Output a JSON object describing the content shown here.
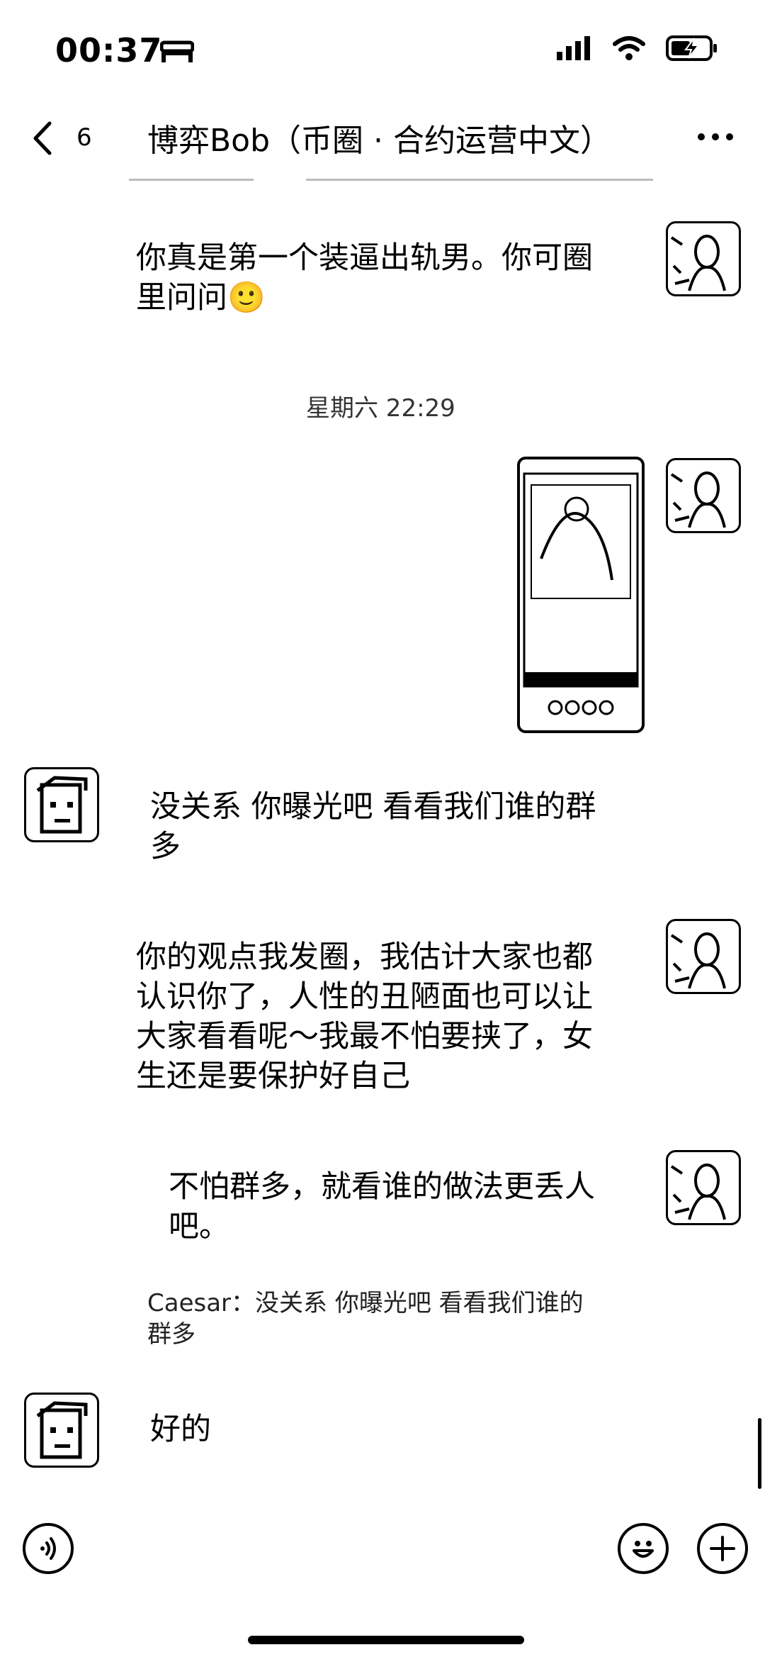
{
  "status_bar": {
    "time": "00:37",
    "time_icon": "bed-icon",
    "signal_icon": "cellular-signal-icon",
    "wifi_icon": "wifi-icon",
    "battery_icon": "battery-charging-icon"
  },
  "nav": {
    "back_icon": "chevron-left-icon",
    "unread_count": "6",
    "title": "博弈Bob（币圈 · 合约运营中文）",
    "more_icon": "more-horizontal-icon"
  },
  "messages": [
    {
      "side": "right",
      "text": "你真是第一个装逼出轨男。你可圈\n里问问🙂"
    },
    {
      "type": "time",
      "text": "星期六 22:29"
    },
    {
      "side": "right",
      "type": "image",
      "text": ""
    },
    {
      "side": "left",
      "text": "没关系 你曝光吧 看看我们谁的群\n多"
    },
    {
      "side": "right",
      "text": "你的观点我发圈，我估计大家也都\n认识你了，人性的丑陋面也可以让\n大家看看呢～我最不怕要挟了，女\n生还是要保护好自己"
    },
    {
      "side": "right",
      "text": "不怕群多，就看谁的做法更丢人\n吧。"
    },
    {
      "type": "quote",
      "text": "Caesar：没关系 你曝光吧 看看我们谁的\n群多"
    },
    {
      "side": "left",
      "text": "好的"
    }
  ],
  "input_bar": {
    "voice_icon": "voice-input-icon",
    "emoji_icon": "emoji-icon",
    "add_icon": "plus-circle-icon"
  }
}
